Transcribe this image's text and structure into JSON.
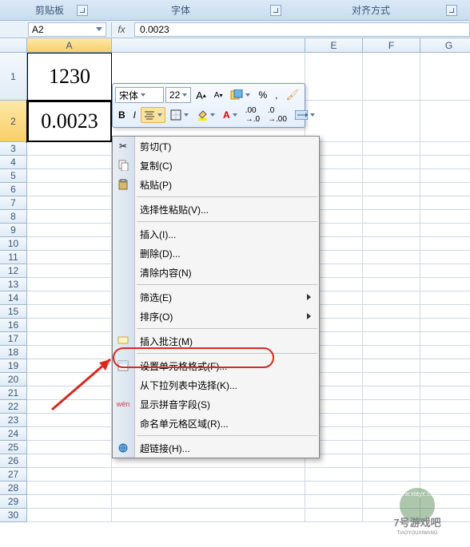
{
  "ribbon": {
    "groups": {
      "clipboard": "剪贴板",
      "font": "字体",
      "alignment": "对齐方式"
    }
  },
  "nameBox": {
    "value": "A2"
  },
  "formulaBar": {
    "fx": "fx",
    "value": "0.0023"
  },
  "columns": [
    {
      "label": "A",
      "width": 106,
      "selected": true
    },
    {
      "label": "E",
      "width": 72
    },
    {
      "label": "F",
      "width": 72
    },
    {
      "label": "G",
      "width": 72
    }
  ],
  "rows": [
    {
      "n": "1",
      "h": 60
    },
    {
      "n": "2",
      "h": 52,
      "selected": true
    },
    {
      "n": "3",
      "h": 17
    },
    {
      "n": "4",
      "h": 17
    },
    {
      "n": "5",
      "h": 17
    },
    {
      "n": "6",
      "h": 17
    },
    {
      "n": "7",
      "h": 17
    },
    {
      "n": "8",
      "h": 17
    },
    {
      "n": "9",
      "h": 17
    },
    {
      "n": "10",
      "h": 17
    },
    {
      "n": "11",
      "h": 17
    },
    {
      "n": "12",
      "h": 17
    },
    {
      "n": "13",
      "h": 17
    },
    {
      "n": "14",
      "h": 17
    },
    {
      "n": "15",
      "h": 17
    },
    {
      "n": "16",
      "h": 17
    },
    {
      "n": "17",
      "h": 17
    },
    {
      "n": "18",
      "h": 17
    },
    {
      "n": "19",
      "h": 17
    },
    {
      "n": "20",
      "h": 17
    },
    {
      "n": "21",
      "h": 17
    },
    {
      "n": "22",
      "h": 17
    },
    {
      "n": "23",
      "h": 17
    },
    {
      "n": "24",
      "h": 17
    },
    {
      "n": "25",
      "h": 17
    },
    {
      "n": "26",
      "h": 17
    },
    {
      "n": "27",
      "h": 17
    },
    {
      "n": "28",
      "h": 17
    },
    {
      "n": "29",
      "h": 17
    },
    {
      "n": "30",
      "h": 17
    }
  ],
  "cells": {
    "A1": "1230",
    "A2": "0.0023"
  },
  "miniToolbar": {
    "fontName": "宋体",
    "fontSize": "22",
    "growFont": "A",
    "shrinkFont": "A",
    "percent": "%"
  },
  "contextMenu": {
    "cut": "剪切(T)",
    "copy": "复制(C)",
    "paste": "粘贴(P)",
    "pasteSpecial": "选择性粘贴(V)...",
    "insert": "插入(I)...",
    "delete": "删除(D)...",
    "clear": "清除内容(N)",
    "filter": "筛选(E)",
    "sort": "排序(O)",
    "comment": "插入批注(M)",
    "formatCells": "设置单元格格式(F)...",
    "pickFromList": "从下拉列表中选择(K)...",
    "showPhonetic": "显示拼音字段(S)",
    "nameRange": "命名单元格区域(R)...",
    "hyperlink": "超链接(H)..."
  },
  "watermark": {
    "url": "www.xiayx.com",
    "sub": "7号游戏吧",
    "pinyin": "TIAOYOUXIWANG"
  }
}
